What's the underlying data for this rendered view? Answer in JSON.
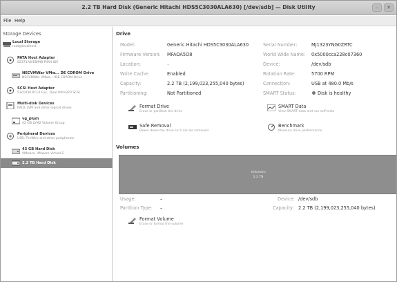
{
  "window": {
    "title": "2.2 TB Hard Disk (Generic Hitachi HDS5C3030ALA630) [/dev/sdb] — Disk Utility",
    "min_glyph": "–",
    "close_glyph": "✕"
  },
  "menu": {
    "file": "File",
    "help": "Help"
  },
  "sidebar": {
    "heading": "Storage Devices",
    "items": [
      {
        "title": "Local Storage",
        "subtitle": "root@localhost",
        "icon": "server-icon"
      },
      {
        "title": "PATA Host Adapter",
        "subtitle": "82371AB/EB/MB PIIX4 IDE",
        "icon": "adapter-icon"
      },
      {
        "title": "NECVMWar VMw... DE CDROM Drive",
        "subtitle": "NECVMWar VMwa... IDE CDROM Drive",
        "icon": "optical-drive-icon"
      },
      {
        "title": "SCSI Host Adapter",
        "subtitle": "53c1030 PCI-X Fus...Dual Ultra320 SCSI",
        "icon": "adapter-icon"
      },
      {
        "title": "Multi-disk Devices",
        "subtitle": "RAID, LVM and other logical drives",
        "icon": "multidisk-icon"
      },
      {
        "title": "vg_plum",
        "subtitle": "42 GB LVM2 Volume Group",
        "icon": "volume-group-icon"
      },
      {
        "title": "Peripheral Devices",
        "subtitle": "USB, FireWire and other peripherals",
        "icon": "peripheral-icon"
      },
      {
        "title": "43 GB Hard Disk",
        "subtitle": "VMware, VMware Virtual S",
        "icon": "hard-disk-icon"
      },
      {
        "title": "2.2 TB Hard Disk",
        "subtitle": "",
        "icon": "hard-disk-icon"
      }
    ]
  },
  "drive": {
    "heading": "Drive",
    "left": [
      {
        "label": "Model:",
        "value": "Generic Hitachi HDS5C3030ALA630"
      },
      {
        "label": "Firmware Version:",
        "value": "MFAOA5O8"
      },
      {
        "label": "Location:",
        "value": "–"
      },
      {
        "label": "Write Cache:",
        "value": "Enabled"
      },
      {
        "label": "Capacity:",
        "value": "2.2 TB (2,199,023,255,040 bytes)"
      },
      {
        "label": "Partitioning:",
        "value": "Not Partitioned"
      }
    ],
    "right": [
      {
        "label": "Serial Number:",
        "value": "MJ1323YNG0ZRTC"
      },
      {
        "label": "World Wide Name:",
        "value": "0x5000cca228c07360"
      },
      {
        "label": "Device:",
        "value": "/dev/sdb"
      },
      {
        "label": "Rotation Rate:",
        "value": "5700 RPM"
      },
      {
        "label": "Connection:",
        "value": "USB at 480.0 Mb/s"
      },
      {
        "label": "SMART Status:",
        "value": "Disk is healthy"
      }
    ],
    "actions": {
      "format": {
        "title": "Format Drive",
        "desc": "Erase or partition the drive"
      },
      "smart": {
        "title": "SMART Data",
        "desc": "View SMART data and run self-tests"
      },
      "remove": {
        "title": "Safe Removal",
        "desc": "Power down the drive so it can be removed"
      },
      "bench": {
        "title": "Benchmark",
        "desc": "Measure drive performance"
      }
    }
  },
  "volumes": {
    "heading": "Volumes",
    "bar_title": "Unknown",
    "bar_size": "2.2 TB",
    "usage": {
      "label": "Usage:",
      "value": "–"
    },
    "ptype": {
      "label": "Partition Type:",
      "value": "–"
    },
    "device": {
      "label": "Device:",
      "value": "/dev/sdb"
    },
    "capacity": {
      "label": "Capacity:",
      "value": "2.2 TB (2,199,023,255,040 bytes)"
    },
    "format": {
      "title": "Format Volume",
      "desc": "Erase or format the volume"
    }
  }
}
